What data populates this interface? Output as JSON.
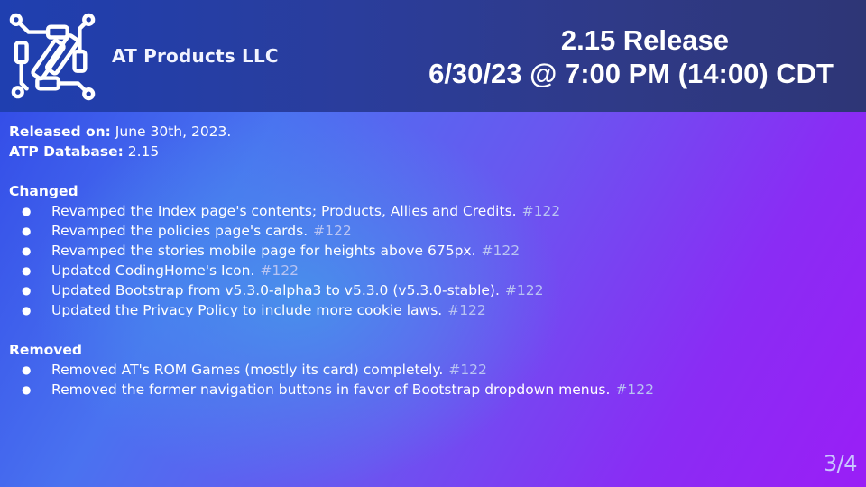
{
  "header": {
    "company_name": "AT Products LLC",
    "logo_icon": "at-products-logo-icon",
    "release_title": "2.15 Release",
    "release_datetime": "6/30/23 @ 7:00 PM (14:00) CDT"
  },
  "meta": {
    "released_label": "Released on:",
    "released_value": "June 30th, 2023.",
    "database_label": "ATP Database:",
    "database_value": "2.15"
  },
  "changed": {
    "title": "Changed",
    "items": [
      {
        "text": "Revamped the Index page's contents; Products, Allies and Credits.",
        "ref": "#122"
      },
      {
        "text": "Revamped the policies page's cards.",
        "ref": "#122"
      },
      {
        "text": "Revamped the stories mobile page for heights above 675px.",
        "ref": "#122"
      },
      {
        "text": "Updated CodingHome's Icon.",
        "ref": "#122"
      },
      {
        "text": "Updated Bootstrap from v5.3.0-alpha3 to v5.3.0 (v5.3.0-stable).",
        "ref": "#122"
      },
      {
        "text": "Updated the Privacy Policy to include more cookie laws.",
        "ref": "#122"
      }
    ]
  },
  "removed": {
    "title": "Removed",
    "items": [
      {
        "text": "Removed AT's ROM Games (mostly its card) completely.",
        "ref": "#122"
      },
      {
        "text": "Removed the former navigation buttons in favor of Bootstrap dropdown menus.",
        "ref": "#122"
      }
    ]
  },
  "bullet_char": "●",
  "page_number": "3/4",
  "colors": {
    "header_bg": "#26389a",
    "background_start": "#2f46e6",
    "background_end": "#9a1ef6",
    "reference_text": "#b9c4f2"
  }
}
